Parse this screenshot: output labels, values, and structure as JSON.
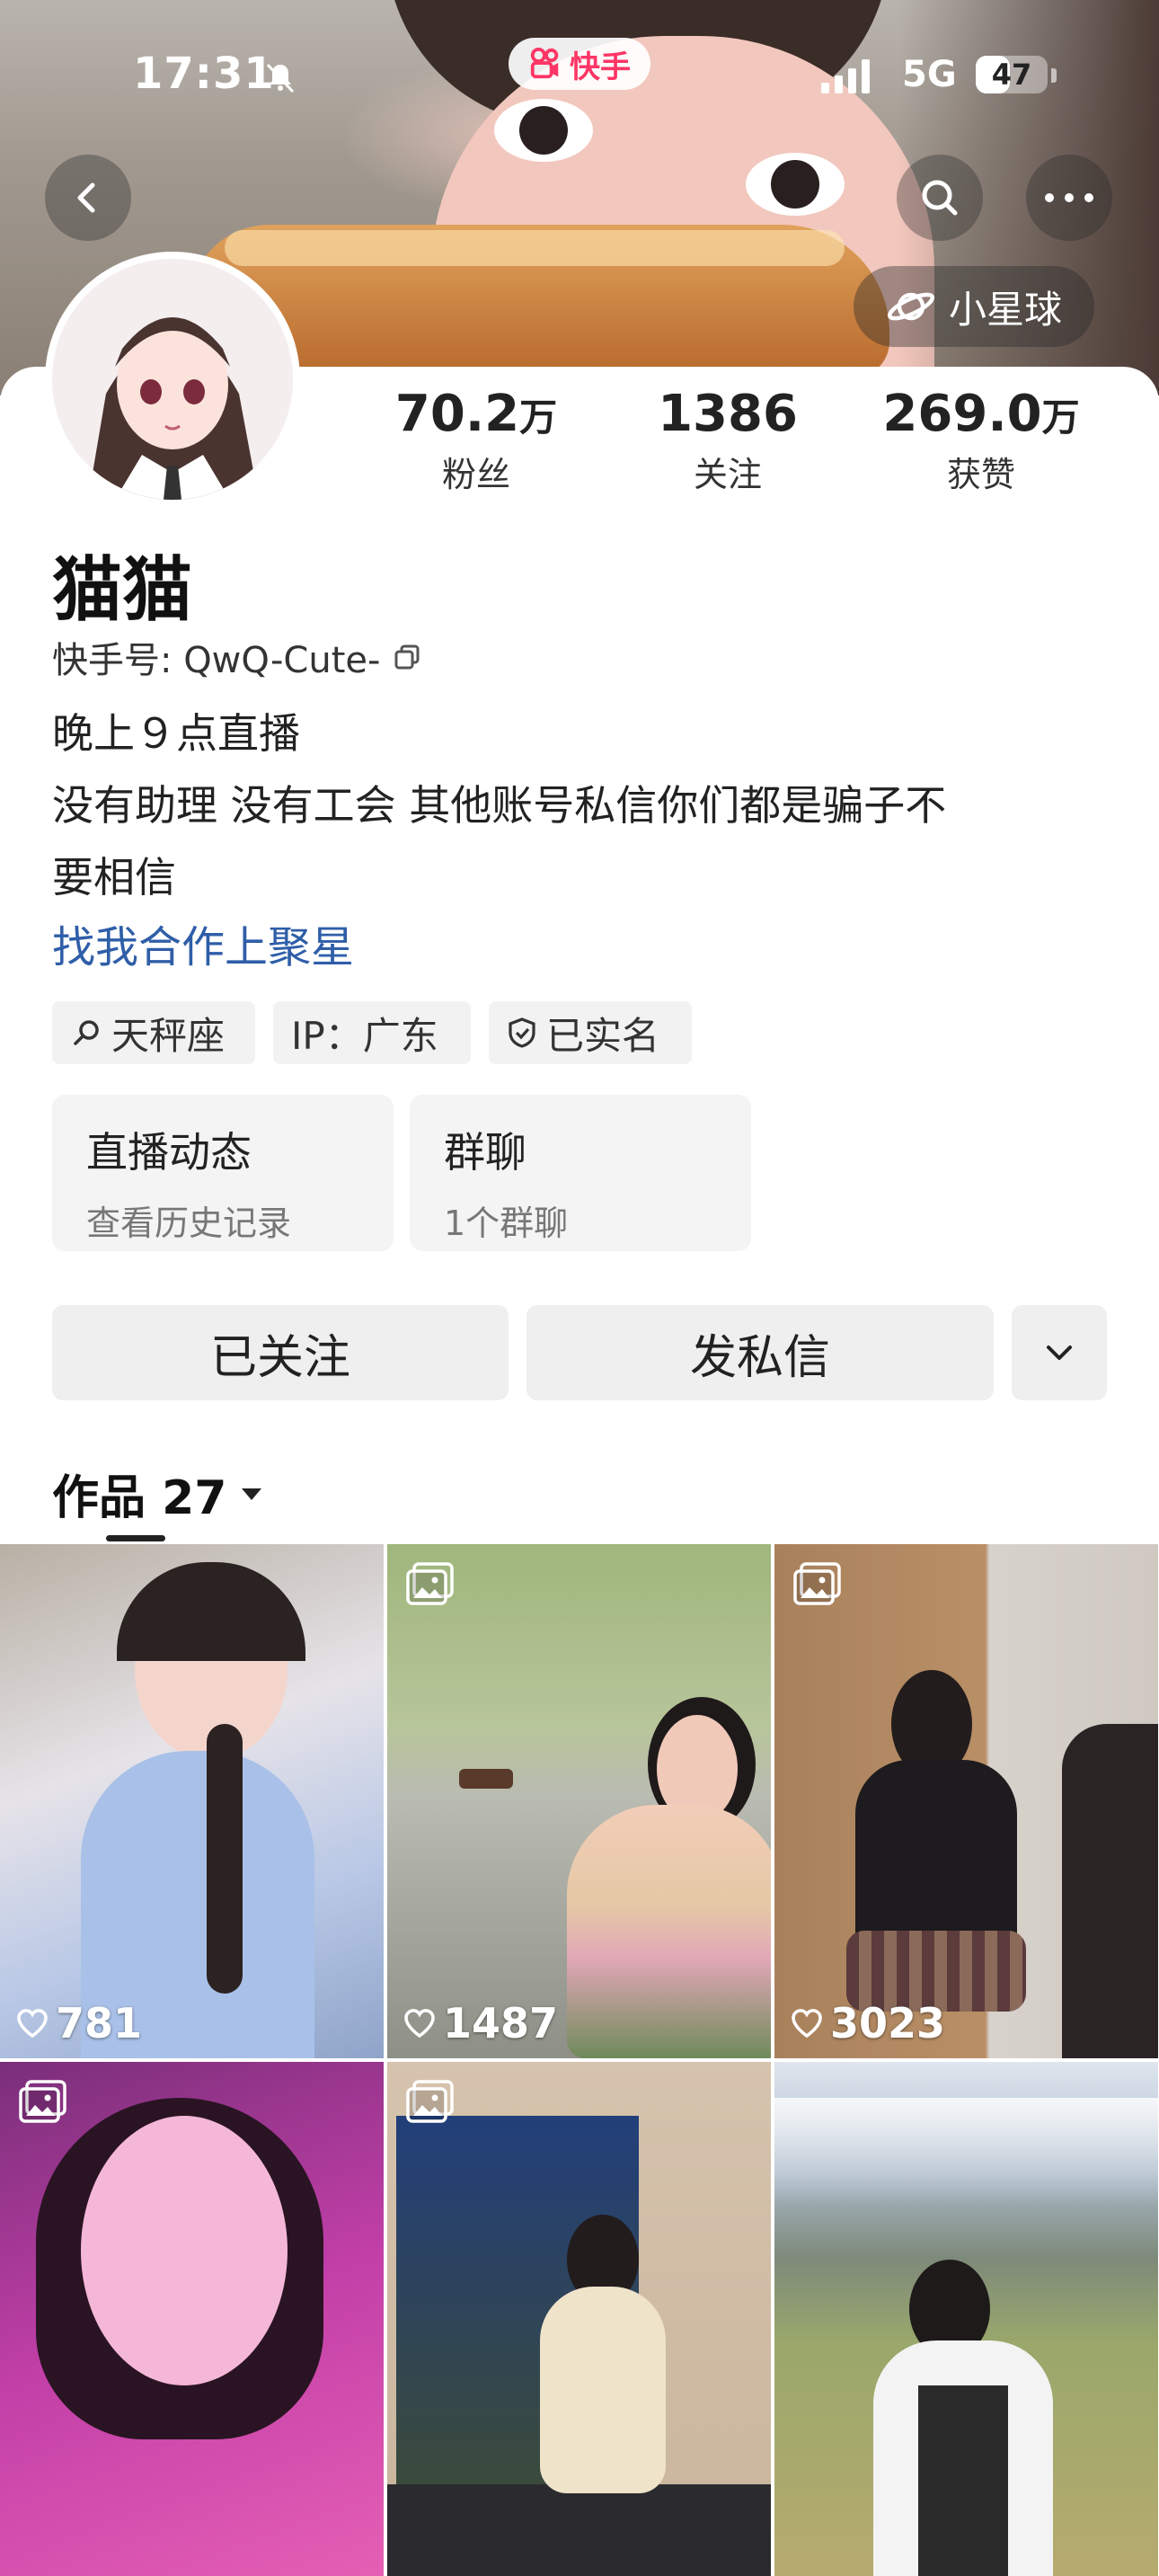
{
  "status_bar": {
    "time": "17:31",
    "network": "5G",
    "battery": "47",
    "battery_level": 0.47
  },
  "app": {
    "name": "快手",
    "brand_color": "#fe3666"
  },
  "header": {
    "planet_button": "小星球"
  },
  "stats": [
    {
      "value": "70.2",
      "unit": "万",
      "label": "粉丝"
    },
    {
      "value": "1386",
      "unit": "",
      "label": "关注"
    },
    {
      "value": "269.0",
      "unit": "万",
      "label": "获赞"
    }
  ],
  "profile": {
    "name": "猫猫",
    "kuaishou_id": "快手号: QwQ-Cute-",
    "bio": [
      "晚上９点直播",
      "没有助理 没有工会 其他账号私信你们都是骗子不",
      "要相信"
    ],
    "link": "找我合作上聚星",
    "link_color": "#2f5ea8"
  },
  "tags": [
    {
      "icon": "search-icon",
      "label": "天秤座"
    },
    {
      "icon": "",
      "label": "IP：广东"
    },
    {
      "icon": "shield-icon",
      "label": "已实名"
    }
  ],
  "info_cards": [
    {
      "title": "直播动态",
      "subtitle": "查看历史记录"
    },
    {
      "title": "群聊",
      "subtitle": "1个群聊"
    }
  ],
  "actions": {
    "follow": "已关注",
    "message": "发私信"
  },
  "works": {
    "label": "作品 27"
  },
  "posts": [
    {
      "likes": "781",
      "is_image": false
    },
    {
      "likes": "1487",
      "is_image": true
    },
    {
      "likes": "3023",
      "is_image": true
    },
    {
      "likes": "",
      "is_image": true
    },
    {
      "likes": "",
      "is_image": true
    },
    {
      "likes": "",
      "is_image": false
    }
  ]
}
